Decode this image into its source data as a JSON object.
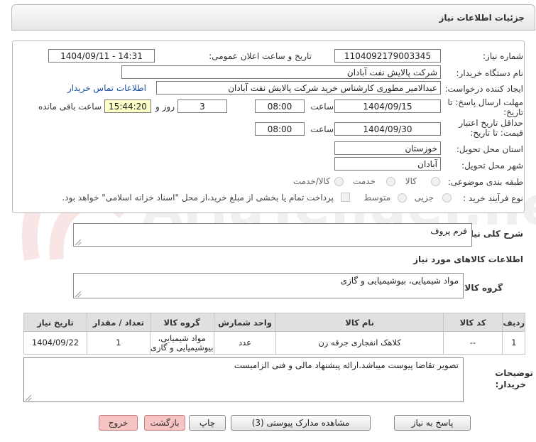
{
  "header": {
    "title": "جزئیات اطلاعات نیاز"
  },
  "fields": {
    "need_number_label": "شماره نیاز:",
    "need_number": "1104092179003345",
    "announce_label": "تاریخ و ساعت اعلان عمومی:",
    "announce_value": "1404/09/11 - 14:31",
    "buyer_org_label": "نام دستگاه خریدار:",
    "buyer_org": "شرکت پالایش نفت آبادان",
    "creator_label": "ایجاد کننده درخواست:",
    "creator": "عبدالامیر مطوری کارشناس خرید  شرکت پالایش نفت آبادان",
    "contact_link": "اطلاعات تماس خریدار",
    "deadline_label_1": "مهلت ارسال پاسخ: تا",
    "deadline_label_2": "تاریخ:",
    "deadline_date": "1404/09/15",
    "time_label": "ساعت",
    "deadline_time": "08:00",
    "days_value": "3",
    "days_label": "روز و",
    "remaining_time": "15:44:20",
    "remaining_label": "ساعت باقی مانده",
    "validity_label_1": "حداقل تاریخ اعتبار",
    "validity_label_2": "قیمت: تا تاریخ:",
    "validity_date": "1404/09/30",
    "validity_time_label": "ساعت",
    "validity_time": "08:00",
    "province_label": "استان محل تحویل:",
    "province": "خوزستان",
    "city_label": "شهر محل تحویل:",
    "city": "آبادان",
    "category_label": "طبقه بندی موضوعی:",
    "category_options": [
      "کالا",
      "خدمت",
      "کالا/خدمت"
    ],
    "purchase_type_label": "نوع فرآیند خرید :",
    "purchase_options": [
      "جزیی",
      "متوسط"
    ],
    "payment_note": "پرداخت تمام یا بخشی از مبلغ خرید،از محل \"اسناد خزانه اسلامی\" خواهد بود."
  },
  "description": {
    "label": "شرح کلی نیاز:",
    "value": "فرم پروف"
  },
  "goods_info_title": "اطلاعات کالاهای مورد نیاز",
  "goods_group": {
    "label": "گروه کالا:",
    "value": "مواد شیمیایی، بیوشیمیایی و  گازی"
  },
  "table": {
    "headers": [
      "ردیف",
      "کد کالا",
      "نام کالا",
      "واحد شمارش",
      "گروه کالا",
      "تعداد / مقدار",
      "تاریخ نیاز"
    ],
    "rows": [
      [
        "1",
        "--",
        "کلاهک انفجاری جرقه زن",
        "عدد",
        "مواد شیمیایی، بیوشیمیایی و گازی",
        "1",
        "1404/09/22"
      ]
    ]
  },
  "buyer_notes": {
    "label_1": "توضیحات",
    "label_2": "خریدار:",
    "value": "تصویر تقاضا پیوست میباشد.ارائه پیشنهاد مالی و فنی الزامیست"
  },
  "buttons": {
    "reply": "پاسخ به نیاز",
    "attachments": "مشاهده مدارک پیوستی (3)",
    "print": "چاپ",
    "back": "بازگشت",
    "exit": "خروج"
  },
  "watermark": "AriaTender.neT",
  "colors": {
    "link": "#1a4fa0",
    "time_bg": "#ffffc8",
    "red_button": "#f7c4c4"
  }
}
